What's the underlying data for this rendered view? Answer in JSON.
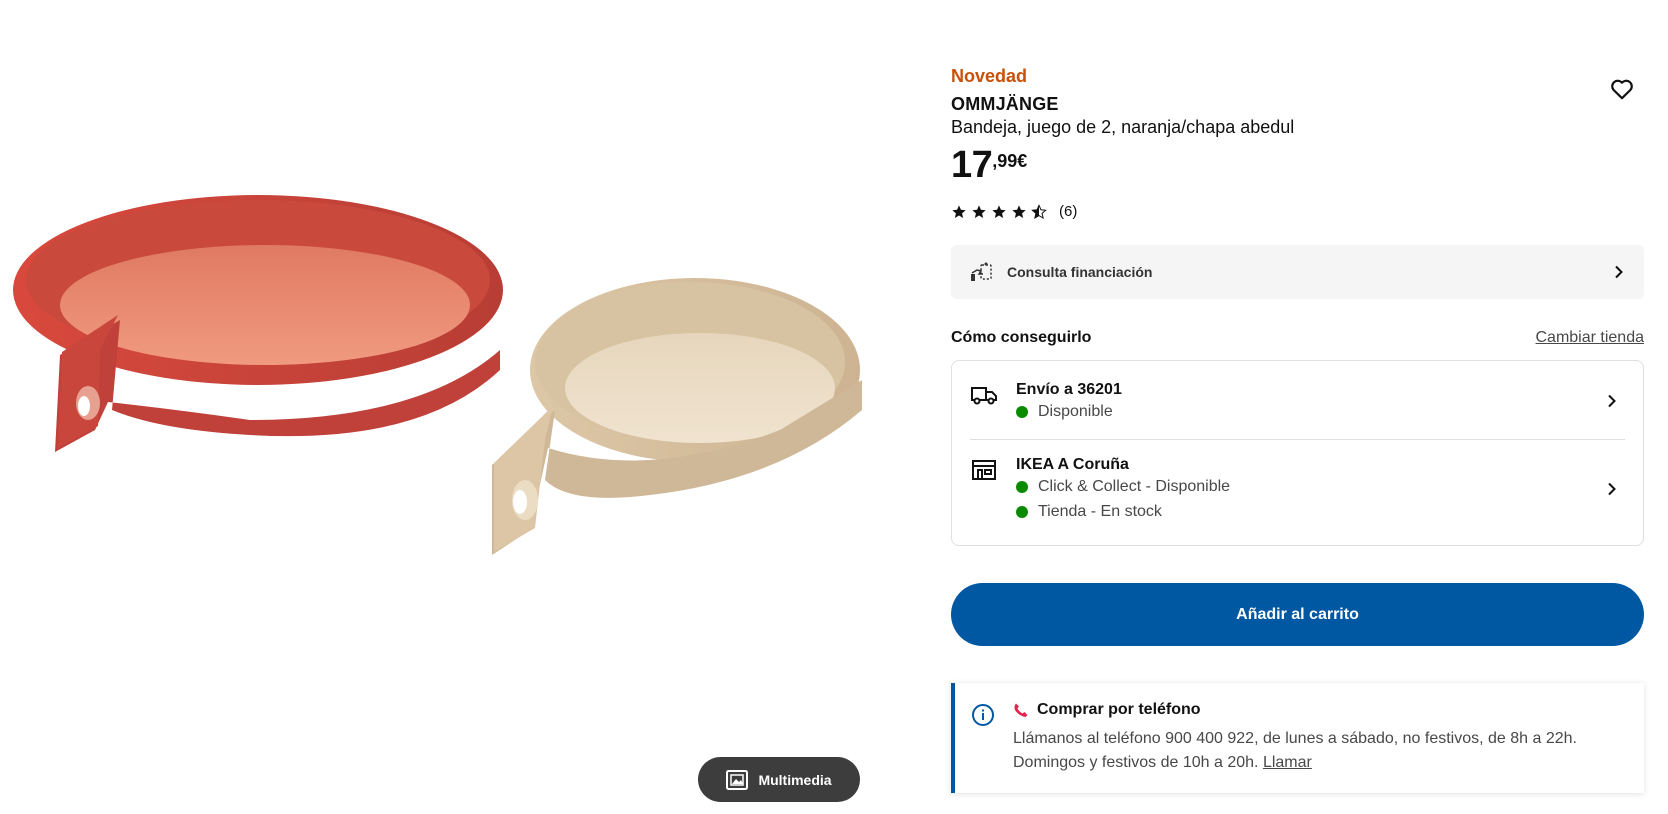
{
  "media": {
    "multimedia_label": "Multimedia",
    "icons": {
      "multimedia": "gallery-icon"
    }
  },
  "product": {
    "badge": "Novedad",
    "name": "OMMJÄNGE",
    "description": "Bandeja, juego de 2, naranja/chapa abedul",
    "price_integer": "17",
    "price_decimal": ",99€",
    "rating_value": 4.5,
    "rating_max": 5,
    "rating_count": "(6)",
    "badge_color": "#ca5008"
  },
  "finance": {
    "label": "Consulta financiación",
    "icon": "financing-icon"
  },
  "availability": {
    "title": "Cómo conseguirlo",
    "change_store": "Cambiar tienda",
    "delivery": {
      "title": "Envío a 36201",
      "status": "Disponible",
      "icon": "truck-icon"
    },
    "store": {
      "title": "IKEA A Coruña",
      "click_collect": "Click & Collect - Disponible",
      "in_store": "Tienda - En stock",
      "icon": "store-icon"
    },
    "status_color": "#0a8a00"
  },
  "cart": {
    "add_label": "Añadir al carrito",
    "button_color": "#0058a3"
  },
  "phone": {
    "title": "Comprar por teléfono",
    "text": "Llámanos al teléfono 900 400 922, de lunes a sábado, no festivos, de 8h a 22h. Domingos y festivos de 10h a 20h.",
    "link": "Llamar",
    "icon": "info-icon"
  }
}
